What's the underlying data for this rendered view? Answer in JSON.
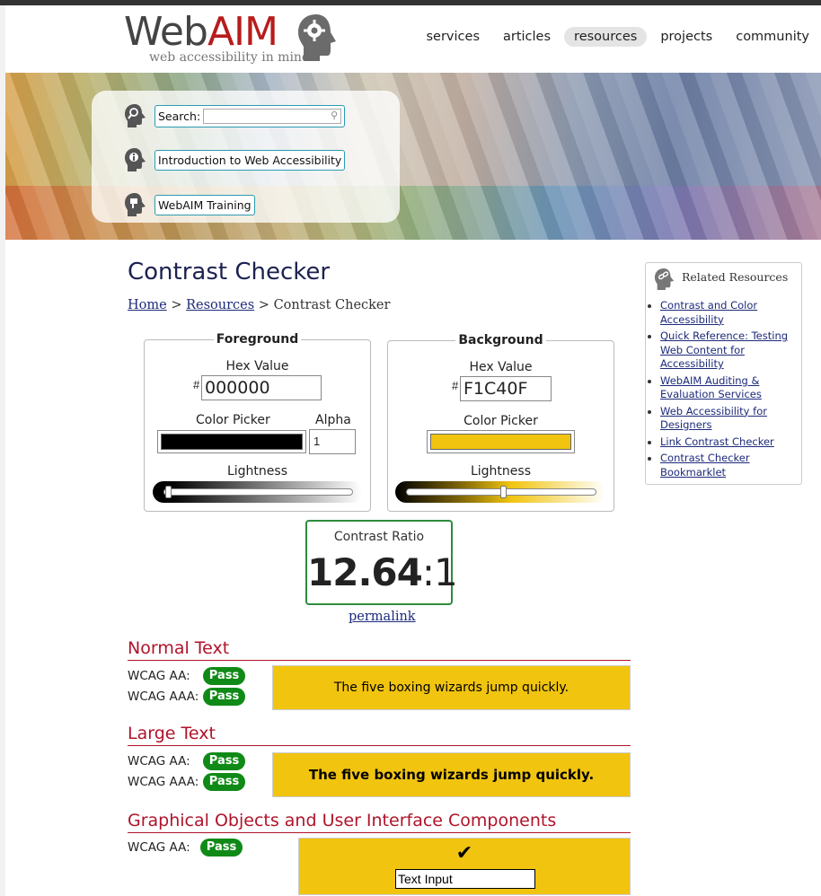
{
  "header": {
    "logo_web": "Web",
    "logo_aim": "AIM",
    "logo_tagline": "web accessibility in mind",
    "nav": [
      "services",
      "articles",
      "resources",
      "projects",
      "community"
    ],
    "nav_active": "resources"
  },
  "quick_links": {
    "search_label": "Search:",
    "search_value": "",
    "intro_link": "Introduction to Web Accessibility",
    "training_link": "WebAIM Training"
  },
  "page": {
    "title": "Contrast Checker",
    "breadcrumb_home": "Home",
    "breadcrumb_resources": "Resources",
    "breadcrumb_current": "Contrast Checker",
    "breadcrumb_sep": ">"
  },
  "foreground": {
    "legend": "Foreground",
    "hex_label": "Hex Value",
    "hash": "#",
    "hex_value": "000000",
    "color_picker_label": "Color Picker",
    "alpha_label": "Alpha",
    "alpha_value": "1",
    "lightness_label": "Lightness",
    "color": "#000000",
    "lightness_level": 0.0
  },
  "background": {
    "legend": "Background",
    "hex_label": "Hex Value",
    "hash": "#",
    "hex_value": "F1C40F",
    "color_picker_label": "Color Picker",
    "lightness_label": "Lightness",
    "color": "#F1C40F",
    "lightness_level": 0.5
  },
  "contrast": {
    "label": "Contrast Ratio",
    "ratio": "12.64",
    "suffix": ":1",
    "permalink": "permalink"
  },
  "results": {
    "normal": {
      "heading": "Normal Text",
      "aa_label": "WCAG AA:",
      "aa_result": "Pass",
      "aaa_label": "WCAG AAA:",
      "aaa_result": "Pass",
      "sample": "The five boxing wizards jump quickly."
    },
    "large": {
      "heading": "Large Text",
      "aa_label": "WCAG AA:",
      "aa_result": "Pass",
      "aaa_label": "WCAG AAA:",
      "aaa_result": "Pass",
      "sample": "The five boxing wizards jump quickly."
    },
    "graphical": {
      "heading": "Graphical Objects and User Interface Components",
      "aa_label": "WCAG AA:",
      "aa_result": "Pass",
      "checkmark": "✔",
      "input_value": "Text Input"
    }
  },
  "related": {
    "heading": "Related Resources",
    "links": [
      "Contrast and Color Accessibility",
      "Quick Reference: Testing Web Content for Accessibility",
      "WebAIM Auditing & Evaluation Services",
      "Web Accessibility for Designers",
      "Link Contrast Checker",
      "Contrast Checker Bookmarklet"
    ]
  },
  "colors": {
    "pass_green": "#108a17",
    "section_red": "#b0132a",
    "title_navy": "#1d2151",
    "link_blue": "#1d2a7a",
    "ratio_border": "#2e8b3d"
  }
}
